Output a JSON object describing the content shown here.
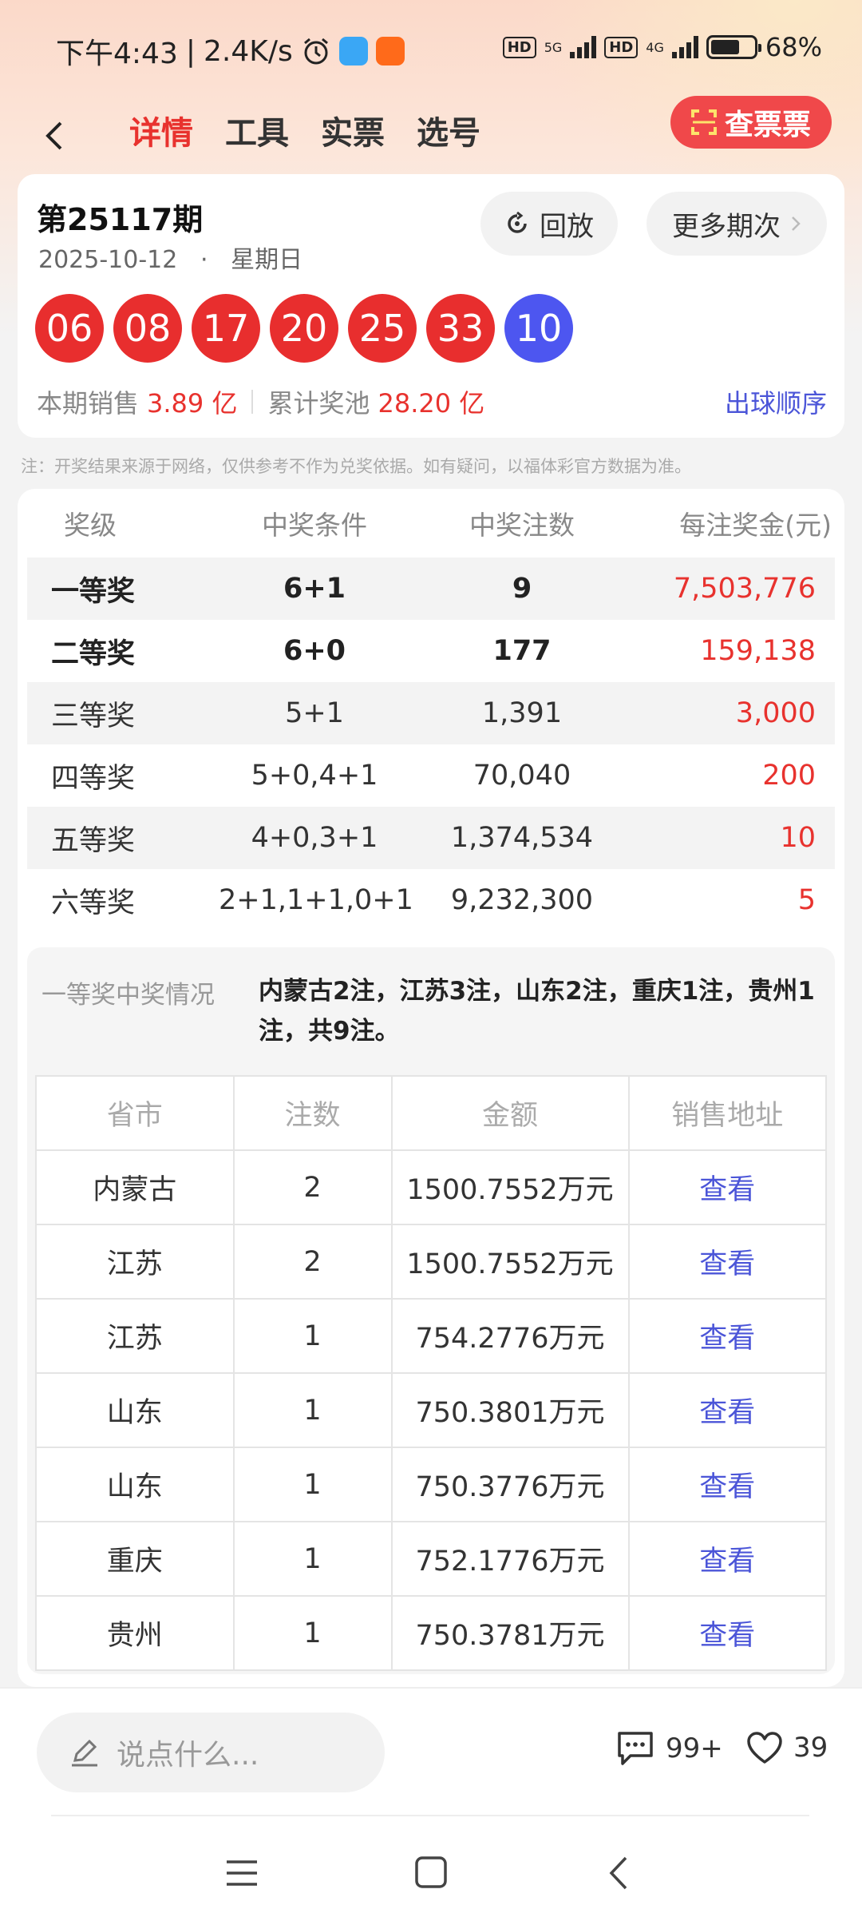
{
  "status": {
    "time": "下午4:43",
    "speed": "2.4K/s",
    "hd1": "HD",
    "net1": "5G",
    "hd2": "HD",
    "net2": "4G",
    "battery": "68%",
    "battery_level": 0.68
  },
  "nav": {
    "tabs": [
      "详情",
      "工具",
      "实票",
      "选号"
    ],
    "active_tab": 0,
    "check_button": "查票票"
  },
  "draw": {
    "issue": "第25117期",
    "date": "2025-10-12",
    "dot": "·",
    "weekday": "星期日",
    "replay": "回放",
    "more_issues": "更多期次",
    "red_balls": [
      "06",
      "08",
      "17",
      "20",
      "25",
      "33"
    ],
    "blue_ball": "10",
    "sales_label": "本期销售",
    "sales_value": "3.89 亿",
    "pool_label": "累计奖池",
    "pool_value": "28.20 亿",
    "order_link": "出球顺序"
  },
  "note": "注：开奖结果来源于网络，仅供参考不作为兑奖依据。如有疑问，以福体彩官方数据为准。",
  "prize_table": {
    "headers": [
      "奖级",
      "中奖条件",
      "中奖注数",
      "每注奖金(元)"
    ],
    "rows": [
      {
        "level": "一等奖",
        "cond": "6+1",
        "count": "9",
        "amount": "7,503,776"
      },
      {
        "level": "二等奖",
        "cond": "6+0",
        "count": "177",
        "amount": "159,138"
      },
      {
        "level": "三等奖",
        "cond": "5+1",
        "count": "1,391",
        "amount": "3,000"
      },
      {
        "level": "四等奖",
        "cond": "5+0,4+1",
        "count": "70,040",
        "amount": "200"
      },
      {
        "level": "五等奖",
        "cond": "4+0,3+1",
        "count": "1,374,534",
        "amount": "10"
      },
      {
        "level": "六等奖",
        "cond": "2+1,1+1,0+1",
        "count": "9,232,300",
        "amount": "5"
      }
    ]
  },
  "first_prize": {
    "label": "一等奖中奖情况",
    "text": "内蒙古2注，江苏3注，山东2注，重庆1注，贵州1注，共9注。",
    "headers": [
      "省市",
      "注数",
      "金额",
      "销售地址"
    ],
    "rows": [
      {
        "prov": "内蒙古",
        "n": "2",
        "amt": "1500.7552万元",
        "link": "查看"
      },
      {
        "prov": "江苏",
        "n": "2",
        "amt": "1500.7552万元",
        "link": "查看"
      },
      {
        "prov": "江苏",
        "n": "1",
        "amt": "754.2776万元",
        "link": "查看"
      },
      {
        "prov": "山东",
        "n": "1",
        "amt": "750.3801万元",
        "link": "查看"
      },
      {
        "prov": "山东",
        "n": "1",
        "amt": "750.3776万元",
        "link": "查看"
      },
      {
        "prov": "重庆",
        "n": "1",
        "amt": "752.1776万元",
        "link": "查看"
      },
      {
        "prov": "贵州",
        "n": "1",
        "amt": "750.3781万元",
        "link": "查看"
      }
    ]
  },
  "bottom": {
    "placeholder": "说点什么...",
    "comments": "99+",
    "likes": "39"
  },
  "colors": {
    "accent_red": "#e8322e",
    "ball_red": "#e82e2e",
    "ball_blue": "#4d56f0",
    "link_blue": "#4b55d8"
  }
}
